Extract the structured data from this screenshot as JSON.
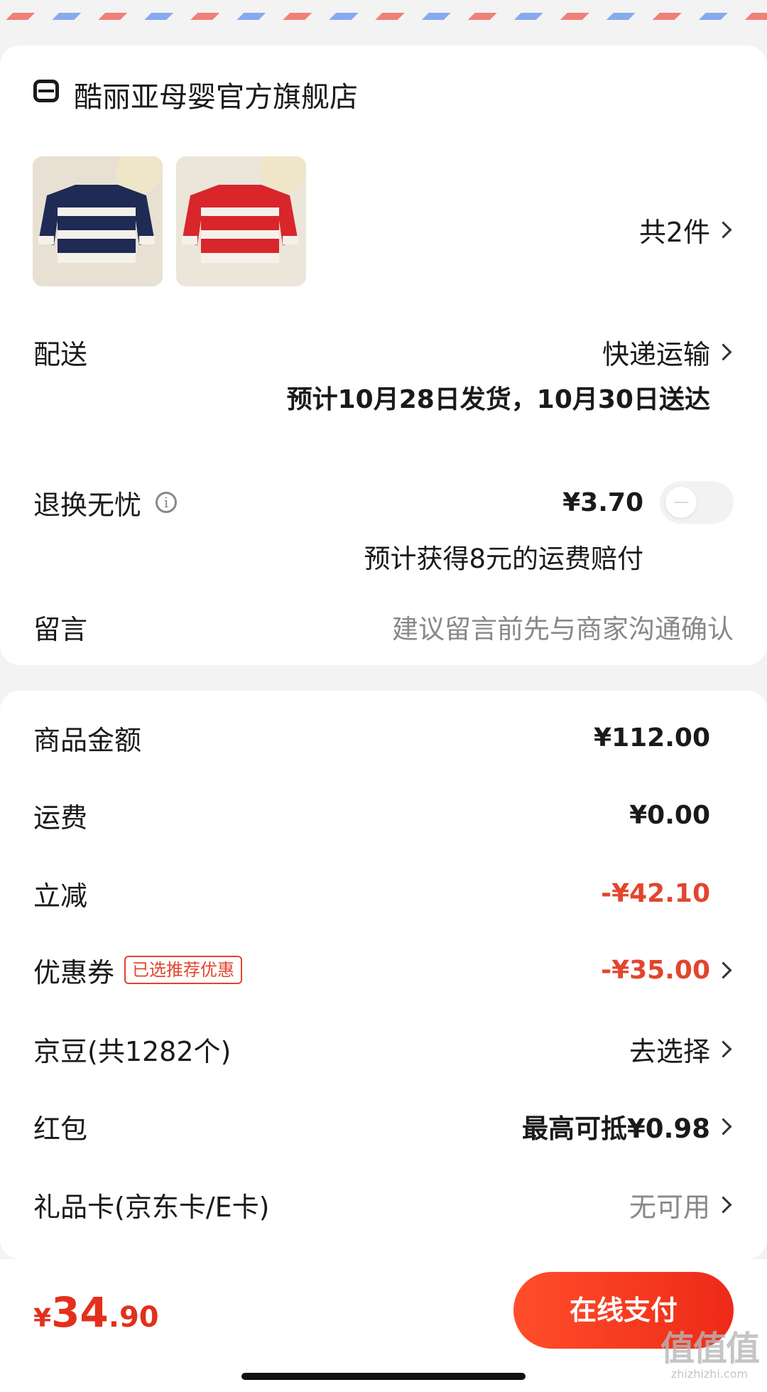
{
  "store": {
    "name": "酷丽亚母婴官方旗舰店"
  },
  "items": {
    "count_label": "共2件"
  },
  "delivery": {
    "label": "配送",
    "method": "快递运输",
    "estimate": "预计10月28日发货，10月30日送达"
  },
  "return_insurance": {
    "label": "退换无忧",
    "info_glyph": "i",
    "price": "¥3.70",
    "note": "预计获得8元的运费赔付",
    "toggle_on": false
  },
  "message": {
    "label": "留言",
    "placeholder": "建议留言前先与商家沟通确认"
  },
  "summary": {
    "goods_amount": {
      "label": "商品金额",
      "value": "¥112.00"
    },
    "shipping": {
      "label": "运费",
      "value": "¥0.00"
    },
    "instant_discount": {
      "label": "立减",
      "value": "-¥42.10"
    },
    "coupon": {
      "label": "优惠券",
      "badge": "已选推荐优惠",
      "value": "-¥35.00"
    },
    "jingdou": {
      "label": "京豆(共1282个)",
      "value": "去选择"
    },
    "red_packet": {
      "label": "红包",
      "value": "最高可抵¥0.98"
    },
    "gift_card": {
      "label": "礼品卡(京东卡/E卡)",
      "value": "无可用"
    }
  },
  "footer": {
    "currency": "¥",
    "total_int": "34",
    "total_dec": ".90",
    "pay_label": "在线支付"
  },
  "watermark": {
    "main": "值值值",
    "sub": "zhizhizhi.com"
  },
  "colors": {
    "accent": "#e2452e",
    "pay_button": "#f23a1e",
    "toggle_track": "#f2f2f2"
  },
  "icons": [
    "store-icon",
    "info-icon",
    "chevron-right-icon"
  ]
}
